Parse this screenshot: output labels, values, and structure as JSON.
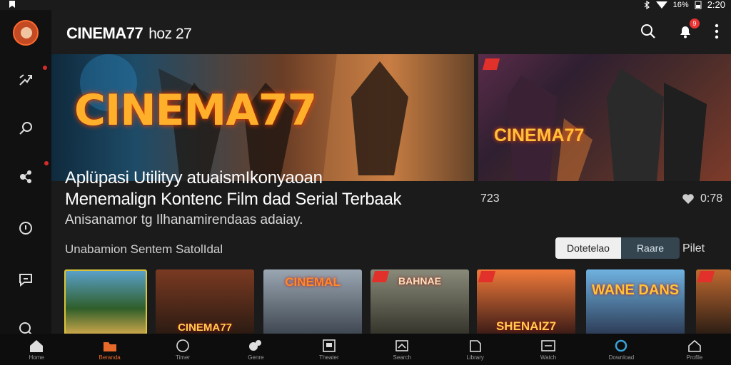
{
  "status_bar": {
    "time": "2:20",
    "battery": "16%"
  },
  "app": {
    "title": "CINEMA77",
    "subtitle": "hoz 27"
  },
  "rail": {
    "items": [
      {
        "icon": "trending-icon"
      },
      {
        "icon": "search-icon"
      },
      {
        "icon": "share-icon"
      },
      {
        "icon": "info-icon"
      },
      {
        "icon": "chat-icon"
      },
      {
        "icon": "settings-icon"
      }
    ]
  },
  "notifications": {
    "count": "9"
  },
  "hero": {
    "logo_text": "CINEMA77",
    "side_logo_text": "CINEMA77",
    "heading_line1": "Aplüpasi Utilityy atuaismIkonyaoan",
    "heading_line2": "Menemalign Kontenc Film dad Serial Terbaak",
    "subtitle": "Anisanamor tg Ilhanamirendaas adaiay.",
    "meta_count": "723",
    "meta_rating": "0:78"
  },
  "section": {
    "label": "Unabamion Sentem SatolIdal",
    "toggle": {
      "active": "Dotetelao",
      "inactive": "Raare"
    },
    "filter": "Pilet"
  },
  "posters": [
    {
      "title": ""
    },
    {
      "title": "CINEMA77"
    },
    {
      "title": "CINEMAL"
    },
    {
      "title": "BAHNAE"
    },
    {
      "title": "SHENAIZ7"
    },
    {
      "title": "WANE DANS"
    },
    {
      "title": ""
    }
  ],
  "bottom_nav": [
    {
      "label": "Home",
      "icon": "home-icon"
    },
    {
      "label": "Beranda",
      "icon": "folder-icon",
      "active": true
    },
    {
      "label": "Timer",
      "icon": "clock-icon"
    },
    {
      "label": "Genre",
      "icon": "genre-icon"
    },
    {
      "label": "Theater",
      "icon": "theater-icon"
    },
    {
      "label": "Search",
      "icon": "search-icon"
    },
    {
      "label": "Library",
      "icon": "library-icon"
    },
    {
      "label": "Watch",
      "icon": "watch-icon"
    },
    {
      "label": "Download",
      "icon": "download-icon"
    },
    {
      "label": "Profile",
      "icon": "profile-icon"
    }
  ],
  "colors": {
    "accent": "#e86a2a",
    "badge": "#e33333",
    "brand_gold": "#ffb02b"
  }
}
